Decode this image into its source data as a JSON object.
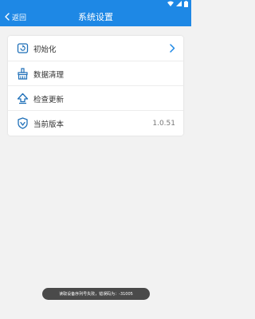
{
  "app_bar": {
    "back_label": "返回",
    "title": "系统设置",
    "color": "#1e88e5"
  },
  "status_bar": {
    "icons": [
      "wifi-icon",
      "signal-icon",
      "battery-icon"
    ]
  },
  "settings": {
    "items": [
      {
        "label": "初始化",
        "icon": "reset-icon",
        "has_chevron": true,
        "value": ""
      },
      {
        "label": "数据清理",
        "icon": "broom-icon",
        "has_chevron": false,
        "value": ""
      },
      {
        "label": "检查更新",
        "icon": "update-icon",
        "has_chevron": false,
        "value": ""
      },
      {
        "label": "当前版本",
        "icon": "shield-icon",
        "has_chevron": false,
        "value": "1.0.51"
      }
    ]
  },
  "toast": {
    "message": "读取设备序列号失败，错误码为：-31005"
  },
  "colors": {
    "accent": "#1e88e5",
    "icon": "#1e6fb8",
    "background": "#f2f2f2",
    "toast": "#4a4a4a"
  }
}
